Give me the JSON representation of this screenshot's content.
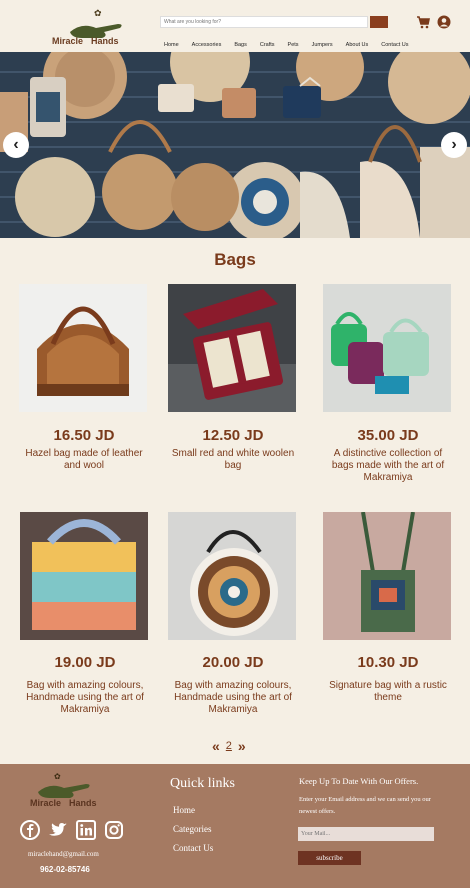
{
  "header": {
    "logo_word1": "Miracle",
    "logo_word2": "Hands",
    "search_placeholder": "What are you looking for?",
    "nav": [
      "Home",
      "Accessories",
      "Bags",
      "Crafts",
      "Pets",
      "Jumpers",
      "About Us",
      "Contact Us"
    ]
  },
  "hero": {
    "prev_icon": "chevron-left-icon",
    "next_icon": "chevron-right-icon"
  },
  "section": {
    "title": "Bags"
  },
  "products": [
    {
      "price": "16.50 JD",
      "desc": "Hazel bag made of leather and wool"
    },
    {
      "price": "12.50 JD",
      "desc": "Small red and white  woolen bag"
    },
    {
      "price": "35.00 JD",
      "desc": "A distinctive collection of bags made with the art of Makramiya"
    },
    {
      "price": "19.00 JD",
      "desc": "Bag with amazing colours, Handmade using the art of Makramiya"
    },
    {
      "price": "20.00 JD",
      "desc": "Bag with amazing colours, Handmade using the art of Makramiya"
    },
    {
      "price": "10.30 JD",
      "desc": "Signature bag with a rustic theme"
    }
  ],
  "pagination": {
    "prev": "«",
    "page": "2",
    "next": "»"
  },
  "footer": {
    "logo_word1": "Miracle",
    "logo_word2": "Hands",
    "email": "miraclehand@gmail.com",
    "phone": "962-02-85746",
    "quick_links_title": "Quick links",
    "quick_links": [
      "Home",
      "Categories",
      "Contact Us"
    ],
    "newsletter_title": "Keep Up To Date With Our Offers.",
    "newsletter_text": "Enter your Email address and we can send you our newest offers.",
    "mail_placeholder": "Your Mail...",
    "subscribe_label": "subscribe",
    "socials": [
      "facebook-icon",
      "twitter-icon",
      "linkedin-icon",
      "instagram-icon"
    ]
  },
  "colors": {
    "background": "#f5efe4",
    "brand": "#7a3b1c",
    "footer": "#a57a62",
    "button": "#8b3f1f"
  }
}
